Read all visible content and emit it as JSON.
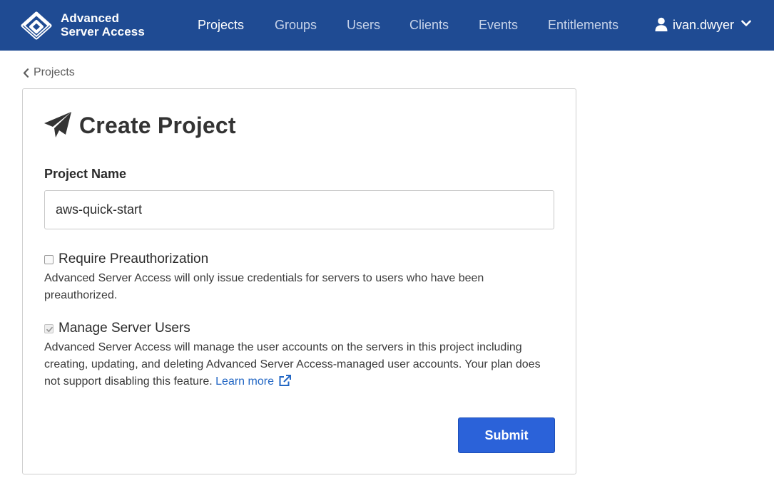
{
  "brand": {
    "line1": "Advanced",
    "line2": "Server Access",
    "logo_icon": "asa-logo-icon"
  },
  "nav": {
    "items": [
      {
        "label": "Projects",
        "active": true
      },
      {
        "label": "Groups",
        "active": false
      },
      {
        "label": "Users",
        "active": false
      },
      {
        "label": "Clients",
        "active": false
      },
      {
        "label": "Events",
        "active": false
      },
      {
        "label": "Entitlements",
        "active": false
      }
    ]
  },
  "user": {
    "name": "ivan.dwyer",
    "icon": "user-icon",
    "menu_icon": "chevron-down-icon"
  },
  "breadcrumb": {
    "label": "Projects",
    "icon": "chevron-left-icon"
  },
  "form": {
    "title": "Create Project",
    "title_icon": "paper-plane-icon",
    "project_name_label": "Project Name",
    "project_name_value": "aws-quick-start",
    "require_preauth": {
      "label": "Require Preauthorization",
      "checked": false,
      "disabled": false,
      "help": "Advanced Server Access will only issue credentials for servers to users who have been preauthorized."
    },
    "manage_users": {
      "label": "Manage Server Users",
      "checked": true,
      "disabled": true,
      "help": "Advanced Server Access will manage the user accounts on the servers in this project including creating, updating, and deleting Advanced Server Access-managed user accounts. Your plan does not support disabling this feature.",
      "link_label": "Learn more",
      "link_icon": "external-link-icon"
    },
    "submit_label": "Submit"
  },
  "colors": {
    "nav_background": "#1f4b93",
    "primary_button": "#2b62d9",
    "link": "#2367c4"
  }
}
